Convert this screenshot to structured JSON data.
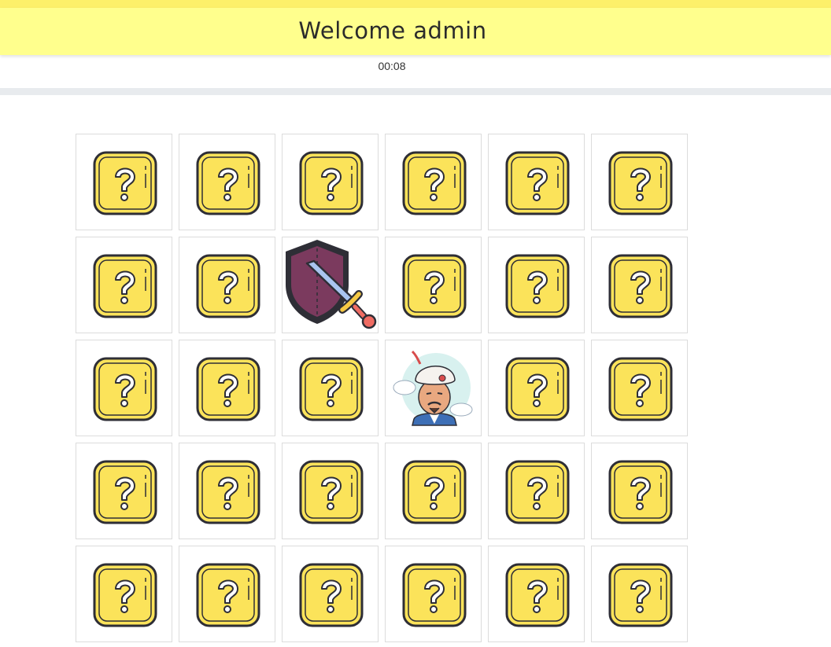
{
  "header": {
    "title": "Welcome admin"
  },
  "timer": {
    "value": "00:08"
  },
  "board": {
    "rows": 5,
    "columns": 6,
    "cards": [
      {
        "state": "hidden",
        "icon": "question-box-icon"
      },
      {
        "state": "hidden",
        "icon": "question-box-icon"
      },
      {
        "state": "hidden",
        "icon": "question-box-icon"
      },
      {
        "state": "hidden",
        "icon": "question-box-icon"
      },
      {
        "state": "hidden",
        "icon": "question-box-icon"
      },
      {
        "state": "hidden",
        "icon": "question-box-icon"
      },
      {
        "state": "hidden",
        "icon": "question-box-icon"
      },
      {
        "state": "hidden",
        "icon": "question-box-icon"
      },
      {
        "state": "revealed",
        "icon": "shield-sword-icon"
      },
      {
        "state": "hidden",
        "icon": "question-box-icon"
      },
      {
        "state": "hidden",
        "icon": "question-box-icon"
      },
      {
        "state": "hidden",
        "icon": "question-box-icon"
      },
      {
        "state": "hidden",
        "icon": "question-box-icon"
      },
      {
        "state": "hidden",
        "icon": "question-box-icon"
      },
      {
        "state": "hidden",
        "icon": "question-box-icon"
      },
      {
        "state": "revealed",
        "icon": "genie-icon"
      },
      {
        "state": "hidden",
        "icon": "question-box-icon"
      },
      {
        "state": "hidden",
        "icon": "question-box-icon"
      },
      {
        "state": "hidden",
        "icon": "question-box-icon"
      },
      {
        "state": "hidden",
        "icon": "question-box-icon"
      },
      {
        "state": "hidden",
        "icon": "question-box-icon"
      },
      {
        "state": "hidden",
        "icon": "question-box-icon"
      },
      {
        "state": "hidden",
        "icon": "question-box-icon"
      },
      {
        "state": "hidden",
        "icon": "question-box-icon"
      },
      {
        "state": "hidden",
        "icon": "question-box-icon"
      },
      {
        "state": "hidden",
        "icon": "question-box-icon"
      },
      {
        "state": "hidden",
        "icon": "question-box-icon"
      },
      {
        "state": "hidden",
        "icon": "question-box-icon"
      },
      {
        "state": "hidden",
        "icon": "question-box-icon"
      },
      {
        "state": "hidden",
        "icon": "question-box-icon"
      }
    ]
  },
  "colors": {
    "header_bg": "#ffff8d",
    "header_strip": "#fdf06a",
    "card_yellow": "#fbe35a",
    "card_outline": "#2e2e36",
    "shield_fill": "#7b3a5e",
    "sword_blade": "#a9c4f0",
    "sword_guard": "#f6c944",
    "sword_pommel": "#ef6b62"
  }
}
